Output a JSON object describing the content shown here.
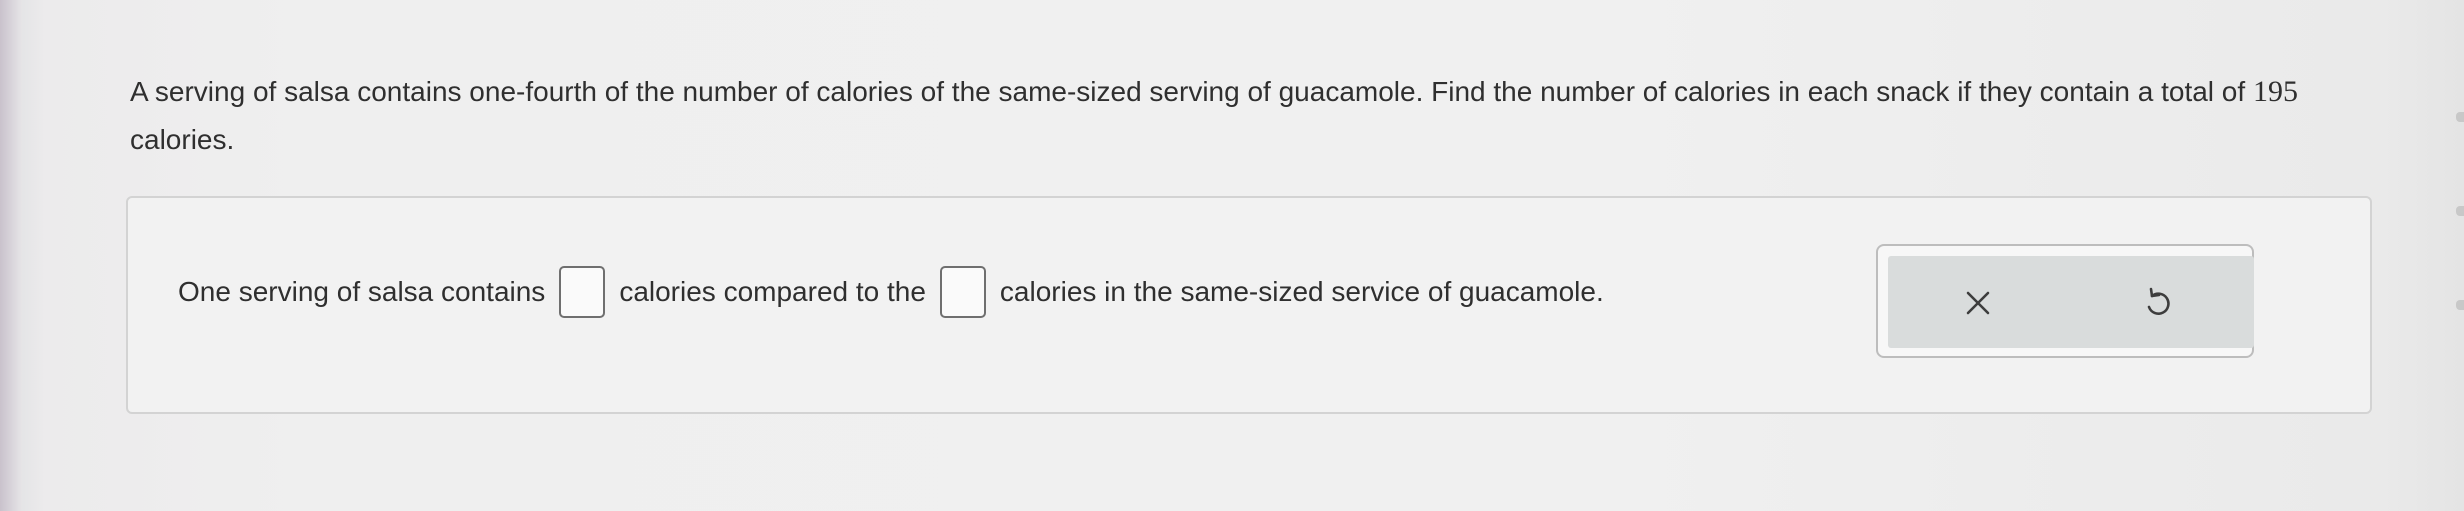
{
  "question": {
    "text_before": "A serving of salsa contains one-fourth of the number of calories of the same-sized serving of guacamole. Find the number of calories in each snack if they contain a total of",
    "total_calories": "195",
    "text_after": "calories."
  },
  "answer": {
    "part1": "One serving of salsa contains",
    "part2": "calories compared to the",
    "part3": "calories in the same-sized service of guacamole.",
    "salsa_value": "",
    "guacamole_value": ""
  },
  "tools": {
    "clear_icon": "close-icon",
    "undo_icon": "undo-icon",
    "icon_color": "#3d3d3d"
  }
}
